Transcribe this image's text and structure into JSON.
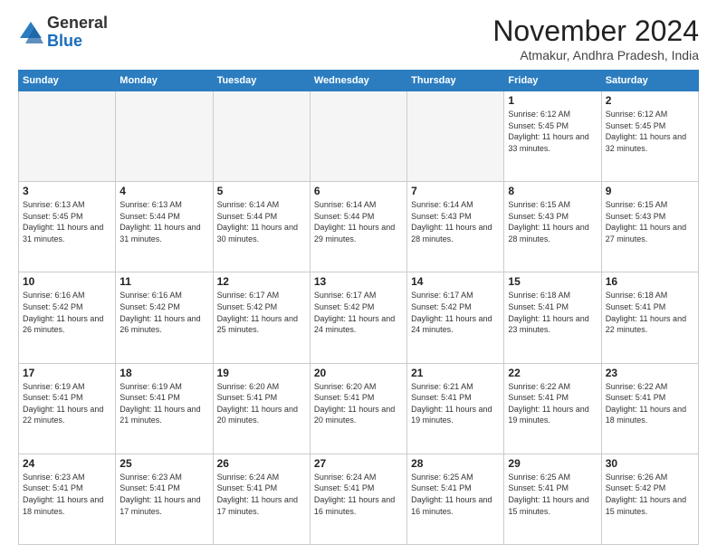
{
  "header": {
    "logo_general": "General",
    "logo_blue": "Blue",
    "month_title": "November 2024",
    "subtitle": "Atmakur, Andhra Pradesh, India"
  },
  "weekdays": [
    "Sunday",
    "Monday",
    "Tuesday",
    "Wednesday",
    "Thursday",
    "Friday",
    "Saturday"
  ],
  "weeks": [
    [
      {
        "day": "",
        "empty": true
      },
      {
        "day": "",
        "empty": true
      },
      {
        "day": "",
        "empty": true
      },
      {
        "day": "",
        "empty": true
      },
      {
        "day": "",
        "empty": true
      },
      {
        "day": "1",
        "sunrise": "6:12 AM",
        "sunset": "5:45 PM",
        "daylight": "11 hours and 33 minutes."
      },
      {
        "day": "2",
        "sunrise": "6:12 AM",
        "sunset": "5:45 PM",
        "daylight": "11 hours and 32 minutes."
      }
    ],
    [
      {
        "day": "3",
        "sunrise": "6:13 AM",
        "sunset": "5:45 PM",
        "daylight": "11 hours and 31 minutes."
      },
      {
        "day": "4",
        "sunrise": "6:13 AM",
        "sunset": "5:44 PM",
        "daylight": "11 hours and 31 minutes."
      },
      {
        "day": "5",
        "sunrise": "6:14 AM",
        "sunset": "5:44 PM",
        "daylight": "11 hours and 30 minutes."
      },
      {
        "day": "6",
        "sunrise": "6:14 AM",
        "sunset": "5:44 PM",
        "daylight": "11 hours and 29 minutes."
      },
      {
        "day": "7",
        "sunrise": "6:14 AM",
        "sunset": "5:43 PM",
        "daylight": "11 hours and 28 minutes."
      },
      {
        "day": "8",
        "sunrise": "6:15 AM",
        "sunset": "5:43 PM",
        "daylight": "11 hours and 28 minutes."
      },
      {
        "day": "9",
        "sunrise": "6:15 AM",
        "sunset": "5:43 PM",
        "daylight": "11 hours and 27 minutes."
      }
    ],
    [
      {
        "day": "10",
        "sunrise": "6:16 AM",
        "sunset": "5:42 PM",
        "daylight": "11 hours and 26 minutes."
      },
      {
        "day": "11",
        "sunrise": "6:16 AM",
        "sunset": "5:42 PM",
        "daylight": "11 hours and 26 minutes."
      },
      {
        "day": "12",
        "sunrise": "6:17 AM",
        "sunset": "5:42 PM",
        "daylight": "11 hours and 25 minutes."
      },
      {
        "day": "13",
        "sunrise": "6:17 AM",
        "sunset": "5:42 PM",
        "daylight": "11 hours and 24 minutes."
      },
      {
        "day": "14",
        "sunrise": "6:17 AM",
        "sunset": "5:42 PM",
        "daylight": "11 hours and 24 minutes."
      },
      {
        "day": "15",
        "sunrise": "6:18 AM",
        "sunset": "5:41 PM",
        "daylight": "11 hours and 23 minutes."
      },
      {
        "day": "16",
        "sunrise": "6:18 AM",
        "sunset": "5:41 PM",
        "daylight": "11 hours and 22 minutes."
      }
    ],
    [
      {
        "day": "17",
        "sunrise": "6:19 AM",
        "sunset": "5:41 PM",
        "daylight": "11 hours and 22 minutes."
      },
      {
        "day": "18",
        "sunrise": "6:19 AM",
        "sunset": "5:41 PM",
        "daylight": "11 hours and 21 minutes."
      },
      {
        "day": "19",
        "sunrise": "6:20 AM",
        "sunset": "5:41 PM",
        "daylight": "11 hours and 20 minutes."
      },
      {
        "day": "20",
        "sunrise": "6:20 AM",
        "sunset": "5:41 PM",
        "daylight": "11 hours and 20 minutes."
      },
      {
        "day": "21",
        "sunrise": "6:21 AM",
        "sunset": "5:41 PM",
        "daylight": "11 hours and 19 minutes."
      },
      {
        "day": "22",
        "sunrise": "6:22 AM",
        "sunset": "5:41 PM",
        "daylight": "11 hours and 19 minutes."
      },
      {
        "day": "23",
        "sunrise": "6:22 AM",
        "sunset": "5:41 PM",
        "daylight": "11 hours and 18 minutes."
      }
    ],
    [
      {
        "day": "24",
        "sunrise": "6:23 AM",
        "sunset": "5:41 PM",
        "daylight": "11 hours and 18 minutes."
      },
      {
        "day": "25",
        "sunrise": "6:23 AM",
        "sunset": "5:41 PM",
        "daylight": "11 hours and 17 minutes."
      },
      {
        "day": "26",
        "sunrise": "6:24 AM",
        "sunset": "5:41 PM",
        "daylight": "11 hours and 17 minutes."
      },
      {
        "day": "27",
        "sunrise": "6:24 AM",
        "sunset": "5:41 PM",
        "daylight": "11 hours and 16 minutes."
      },
      {
        "day": "28",
        "sunrise": "6:25 AM",
        "sunset": "5:41 PM",
        "daylight": "11 hours and 16 minutes."
      },
      {
        "day": "29",
        "sunrise": "6:25 AM",
        "sunset": "5:41 PM",
        "daylight": "11 hours and 15 minutes."
      },
      {
        "day": "30",
        "sunrise": "6:26 AM",
        "sunset": "5:42 PM",
        "daylight": "11 hours and 15 minutes."
      }
    ]
  ]
}
